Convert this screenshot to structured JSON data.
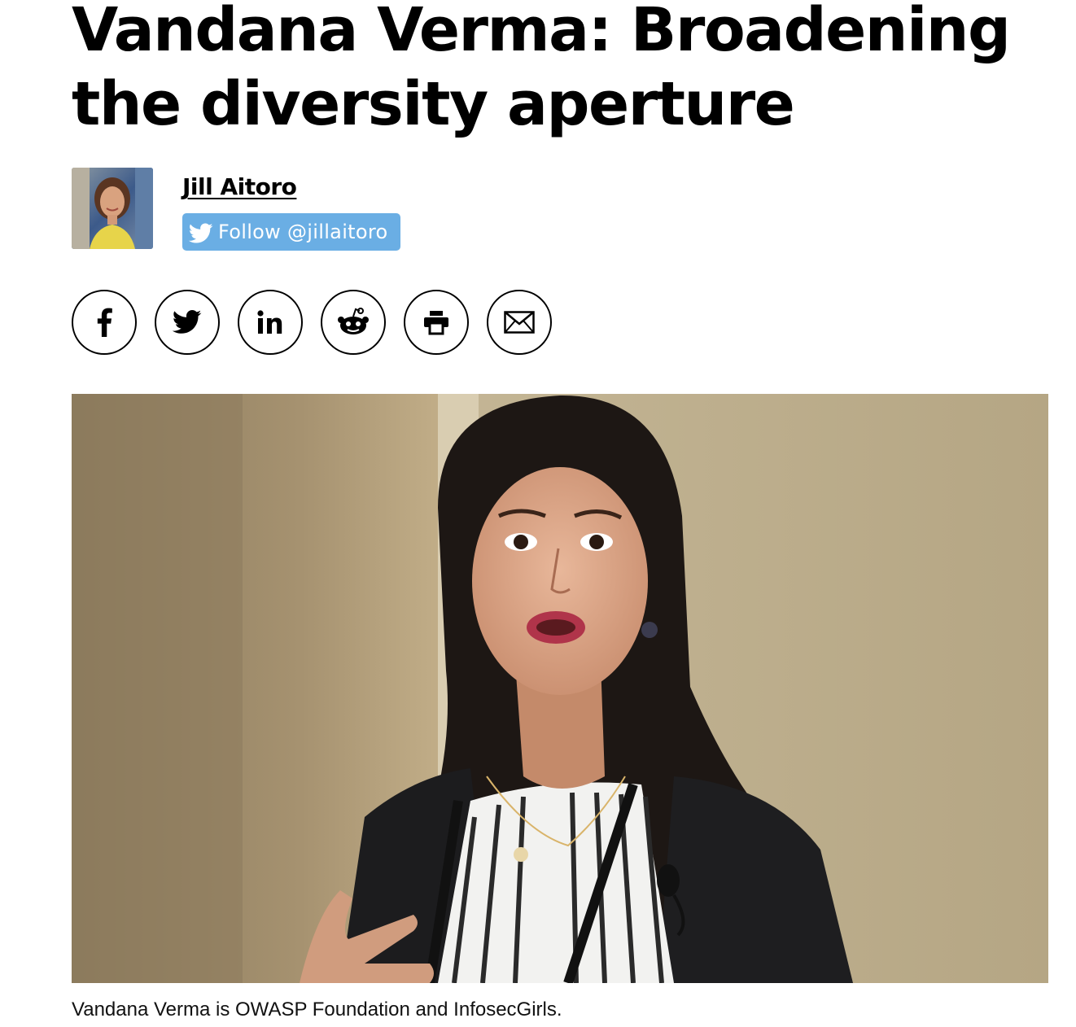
{
  "article": {
    "title": "Vandana Verma: Broadening the diversity aperture",
    "caption": "Vandana Verma is OWASP Foundation and InfosecGirls."
  },
  "author": {
    "name": "Jill Aitoro",
    "follow_label": "Follow @jillaitoro",
    "follow_color": "#6aaee4"
  },
  "share": {
    "buttons": [
      {
        "name": "facebook",
        "icon": "facebook-icon"
      },
      {
        "name": "twitter",
        "icon": "twitter-icon"
      },
      {
        "name": "linkedin",
        "icon": "linkedin-icon"
      },
      {
        "name": "reddit",
        "icon": "reddit-icon"
      },
      {
        "name": "print",
        "icon": "print-icon"
      },
      {
        "name": "email",
        "icon": "email-icon"
      }
    ]
  }
}
